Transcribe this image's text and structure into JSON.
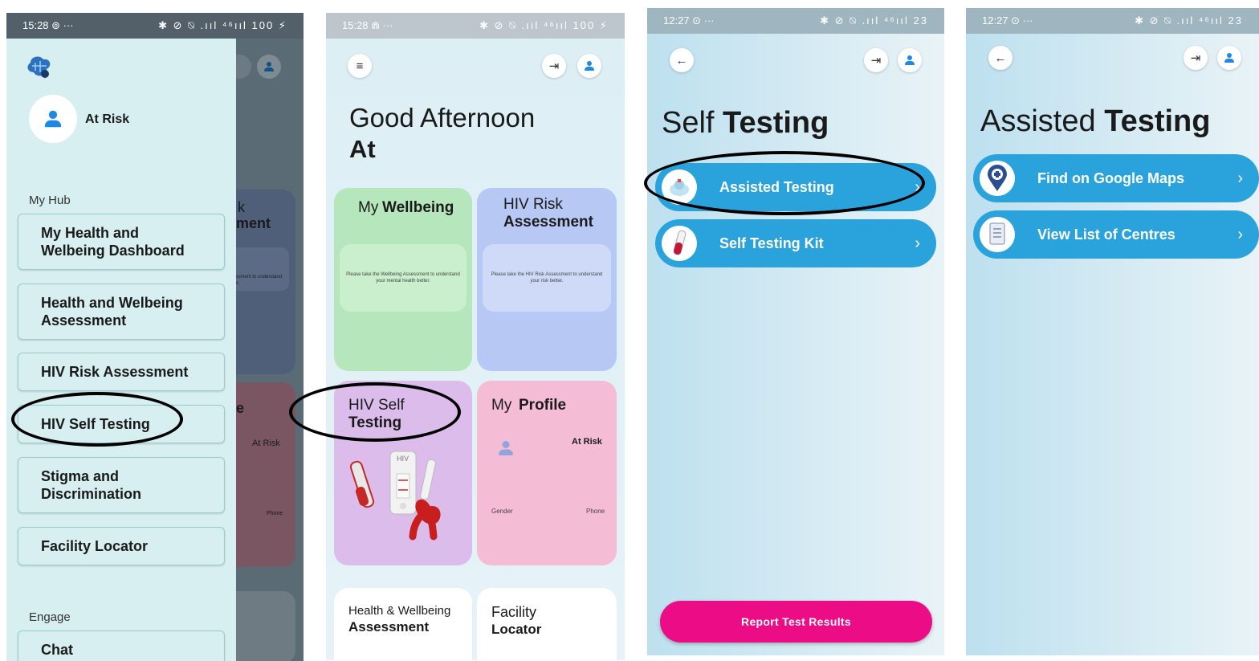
{
  "screen1": {
    "status_time": "15:28 ⊚ ···",
    "status_right": "✱ ⊘ ⍉ .ııl ⁴⁶ııl 100 ⚡",
    "profile_name": "At Risk",
    "section_hub": "My Hub",
    "section_engage": "Engage",
    "menu": [
      "My Health and Welbeing Dashboard",
      "Health and Welbeing Assessment",
      "HIV Risk Assessment",
      "HIV Self Testing",
      "Stigma and Discrimination",
      "Facility  Locator",
      "Chat"
    ],
    "behind": {
      "k_text": "k",
      "ment_text": "ment",
      "e_text": "e",
      "at_risk": "At Risk",
      "phone": "Phone",
      "assess_text": "essment to understand",
      "ter_text": "ter."
    }
  },
  "screen2": {
    "status_time": "15:28 ⋒ ···",
    "status_right": "✱ ⊘ ⍉ .ııl ⁴⁶ııl 100 ⚡",
    "greeting": "Good Afternoon",
    "name": "At",
    "tiles": {
      "wellbeing": {
        "light": "My",
        "bold": "Wellbeing",
        "note": "Please take the Wellbeing Assessment to understand your mental health better."
      },
      "hiv_risk": {
        "light": "HIV Risk",
        "bold": "Assessment",
        "note": "Please take the HIV Risk Assessment to understand your risk better."
      },
      "self_testing": {
        "light": "HIV Self",
        "bold": "Testing",
        "kit_label": "HIV",
        "control": "Control",
        "test": "Test"
      },
      "profile": {
        "light": "My",
        "bold": "Profile",
        "at_risk": "At Risk",
        "gender": "Gender",
        "phone": "Phone"
      },
      "health": {
        "light": "Health & Wellbeing",
        "bold": "Assessment"
      },
      "facility": {
        "light": "Facility",
        "bold": "Locator"
      }
    }
  },
  "screen3": {
    "status_time": "12:27 ⊙ ···",
    "status_right": "✱ ⊘ ⍉ .ııl ⁴⁶ııl 23",
    "title_light": "Self",
    "title_bold": "Testing",
    "options": [
      {
        "label": "Assisted Testing",
        "icon": "nurse-icon"
      },
      {
        "label": "Self Testing Kit",
        "icon": "test-tube-icon"
      }
    ],
    "report_button": "Report Test Results",
    "chevron": "›"
  },
  "screen4": {
    "status_time": "12:27 ⊙ ···",
    "status_right": "✱ ⊘ ⍉ .ııl ⁴⁶ııl 23",
    "title_light": "Assisted",
    "title_bold": "Testing",
    "options": [
      {
        "label": "Find on Google Maps",
        "icon": "map-pin-icon"
      },
      {
        "label": "View List of Centres",
        "icon": "document-list-icon"
      }
    ],
    "chevron": "›"
  },
  "icons": {
    "logout": "⇥",
    "back": "←",
    "hamburger": "≡"
  },
  "colors": {
    "accent_blue": "#2aa3dd",
    "report_pink": "#ec0c85",
    "wellbeing_green": "#b6e6bb",
    "risk_blue": "#b8c8f5",
    "self_testing_purple": "#dcbceb",
    "profile_pink": "#f5bdd5"
  }
}
